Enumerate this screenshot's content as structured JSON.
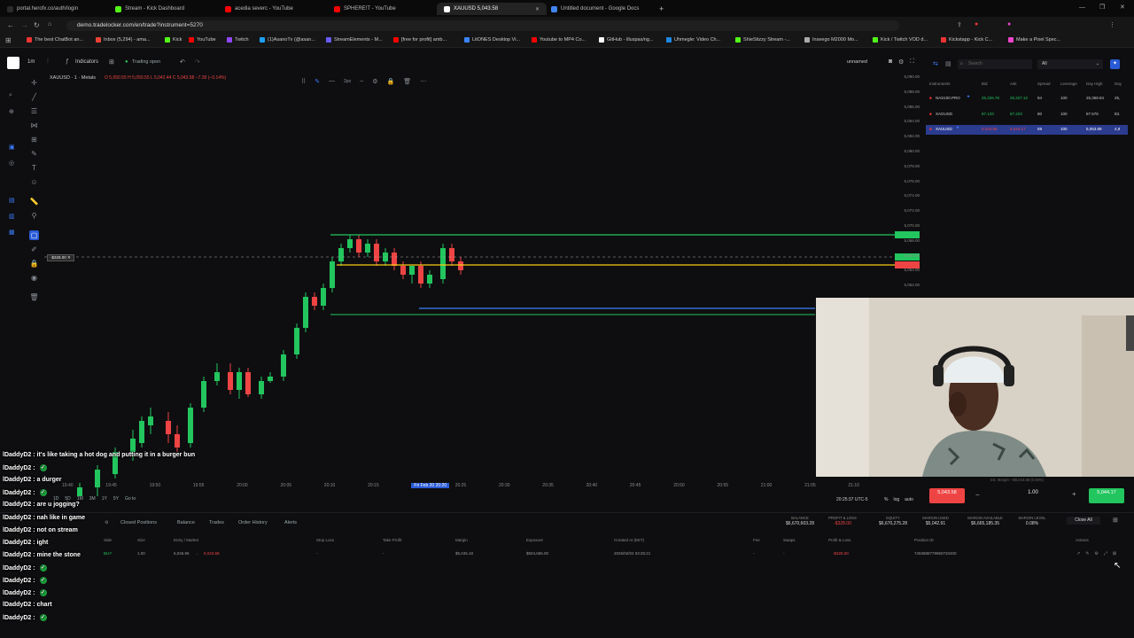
{
  "browser": {
    "tabs": [
      {
        "label": "portal.herofx.co/auth/login",
        "color": "#2b2b2b"
      },
      {
        "label": "Stream - Kick Dashboard",
        "color": "#53fc18"
      },
      {
        "label": "acedia severc - YouTube",
        "color": "#ff0000"
      },
      {
        "label": "SPHERE!T - YouTube",
        "color": "#ff0000"
      },
      {
        "label": "XAUUSD 5,043.58",
        "color": "#ffffff"
      },
      {
        "label": "Untitled document - Google Docs",
        "color": "#4285f4"
      }
    ],
    "new_tab": "+",
    "url": "demo.tradelocker.com/en/trade?instrument=5270",
    "bookmarks": [
      "The best ChatBot an...",
      "Inbox (5,294) - ama...",
      "Kick",
      "YouTube",
      "Twitch",
      "(1)AsanoTv (@asan...",
      "StreamElements - M...",
      "[free for profit] amb...",
      "LitONES Desktop Vi...",
      "Youtube to MP4 Co...",
      "GitHub - illuspas/ng...",
      "Uhmegle: Video Ch...",
      "ShieStizzy Stream -...",
      "Inseego M2000 Mo...",
      "Kick / Twitch VOD d...",
      "Kickstapp - Kick C...",
      "Make a Pixel Spec..."
    ]
  },
  "toolbar": {
    "timeframe": "1m",
    "indicators": "Indicators",
    "trading_open": "Trading open",
    "layout_name": "unnamed",
    "stroke": "2px"
  },
  "chart": {
    "symbol": "XAUUSD · 1 · Metals",
    "ohlc": "O 5,050.55 H 5,050.55 L 5,042.44 C 5,043.58 −7.39 (−0.14%)",
    "order_tag": "-$328.00",
    "price_labels": [
      "5,090.00",
      "5,088.00",
      "5,086.00",
      "5,084.00",
      "5,082.00",
      "5,080.00",
      "5,078.00",
      "5,076.00",
      "5,074.00",
      "5,072.00",
      "5,070.00",
      "5,068.00",
      "5,066.00",
      "5,064.00",
      "5,062.00",
      "5,060.00",
      "5,058.00",
      "5,056.00",
      "5,054.00",
      "5,052.00",
      "5,050.00",
      "5,048.00",
      "5,046.00",
      "5,044.00",
      "5,042.00",
      "5,040.00",
      "5,038.00"
    ],
    "time_labels": [
      "19:40",
      "19:45",
      "19:50",
      "19:55",
      "20:00",
      "20:05",
      "20:10",
      "20:15",
      "Fri Feb 20 20:20",
      "20:25",
      "20:30",
      "20:35",
      "20:40",
      "20:45",
      "20:50",
      "20:55",
      "21:00",
      "21:05",
      "21:10"
    ],
    "clock": "20:25:37 UTC-5",
    "scale_opts": [
      "%",
      "log",
      "auto"
    ],
    "ranges": [
      "1D",
      "5D",
      "1M",
      "3M",
      "1Y",
      "5Y",
      "Go to"
    ]
  },
  "watchlist": {
    "search_placeholder": "Search",
    "filter": "All",
    "headers": [
      "Instruments",
      "Bid",
      "Ask",
      "Spread",
      "Leverage",
      "Day High",
      "Day"
    ],
    "rows": [
      {
        "name": "NAS100.PRO",
        "bid": "25,326.76",
        "ask": "25,327.12",
        "spread": "94",
        "lev": "100",
        "high": "25,358.84",
        "day": "25,"
      },
      {
        "name": "XAGUSD",
        "bid": "87.133",
        "ask": "87.223",
        "spread": "80",
        "lev": "100",
        "high": "87.576",
        "day": "83."
      },
      {
        "name": "XAUUSD",
        "bid": "5,043.58",
        "ask": "5,044.17",
        "spread": "59",
        "lev": "100",
        "high": "5,053.89",
        "day": "4,9"
      }
    ]
  },
  "trade": {
    "sell_price": "5,043.58",
    "buy_price": "5,044.17",
    "quantity": "1.00",
    "margin_label": "Init. Margin: ~$5,043.88 (0.08%)"
  },
  "chat": [
    {
      "user": "lDaddyD2",
      "text": "it's like taking a hot dog and putting it in a burger bun",
      "check": false
    },
    {
      "user": "lDaddyD2",
      "text": "",
      "check": true
    },
    {
      "user": "lDaddyD2",
      "text": "a durger",
      "check": false
    },
    {
      "user": "lDaddyD2",
      "text": "",
      "check": true
    },
    {
      "user": "lDaddyD2",
      "text": "are u jogging?",
      "check": false
    },
    {
      "user": "lDaddyD2",
      "text": "nah like in game",
      "check": false
    },
    {
      "user": "lDaddyD2",
      "text": "not on stream",
      "check": false
    },
    {
      "user": "lDaddyD2",
      "text": "ight",
      "check": false
    },
    {
      "user": "lDaddyD2",
      "text": "mine the stone",
      "check": false
    },
    {
      "user": "lDaddyD2",
      "text": "",
      "check": true
    },
    {
      "user": "lDaddyD2",
      "text": "",
      "check": true
    },
    {
      "user": "lDaddyD2",
      "text": "",
      "check": true
    },
    {
      "user": "lDaddyD2",
      "text": "chart",
      "check": false
    },
    {
      "user": "lDaddyD2",
      "text": "",
      "check": true
    }
  ],
  "positions": {
    "tabs": [
      "Closed Positions",
      "Balance",
      "Trades",
      "Order History",
      "Alerts"
    ],
    "summary": [
      {
        "label": "BALANCE",
        "value": "$6,670,603.28"
      },
      {
        "label": "PROFIT & LOSS",
        "value": "-$328.00"
      },
      {
        "label": "EQUITY",
        "value": "$6,670,275.28"
      },
      {
        "label": "MARGIN USED",
        "value": "$5,042.91"
      },
      {
        "label": "MARGIN AVAILABLE",
        "value": "$6,665,185.35"
      },
      {
        "label": "MARGIN LEVEL",
        "value": "0.08%"
      }
    ],
    "close_all": "Close All",
    "headers": [
      "Side",
      "Size",
      "Entry / Market",
      "Stop Loss",
      "Take Profit",
      "Margin",
      "Exposure",
      "Created At (EET)",
      "Fee",
      "Swaps",
      "Profit & Loss",
      "Position ID",
      "Actions"
    ],
    "row": {
      "side": "BUY",
      "size": "1.00",
      "entry": "5,046.86",
      "market": "5,043.58",
      "sl": "-",
      "tp": "-",
      "margin": "$5,046.18",
      "exposure": "$504,686.00",
      "created": "2026/02/04 03:25:21",
      "fee": "-",
      "swaps": "-",
      "pnl": "-$328.00",
      "id": "7493888779950720400"
    }
  },
  "colors": {
    "accent": "#2a5bd7",
    "up": "#22c55e",
    "down": "#ef4444",
    "tp_line": "#22c55e",
    "entry_line": "#facc15",
    "sl_line": "#3b82f6"
  }
}
